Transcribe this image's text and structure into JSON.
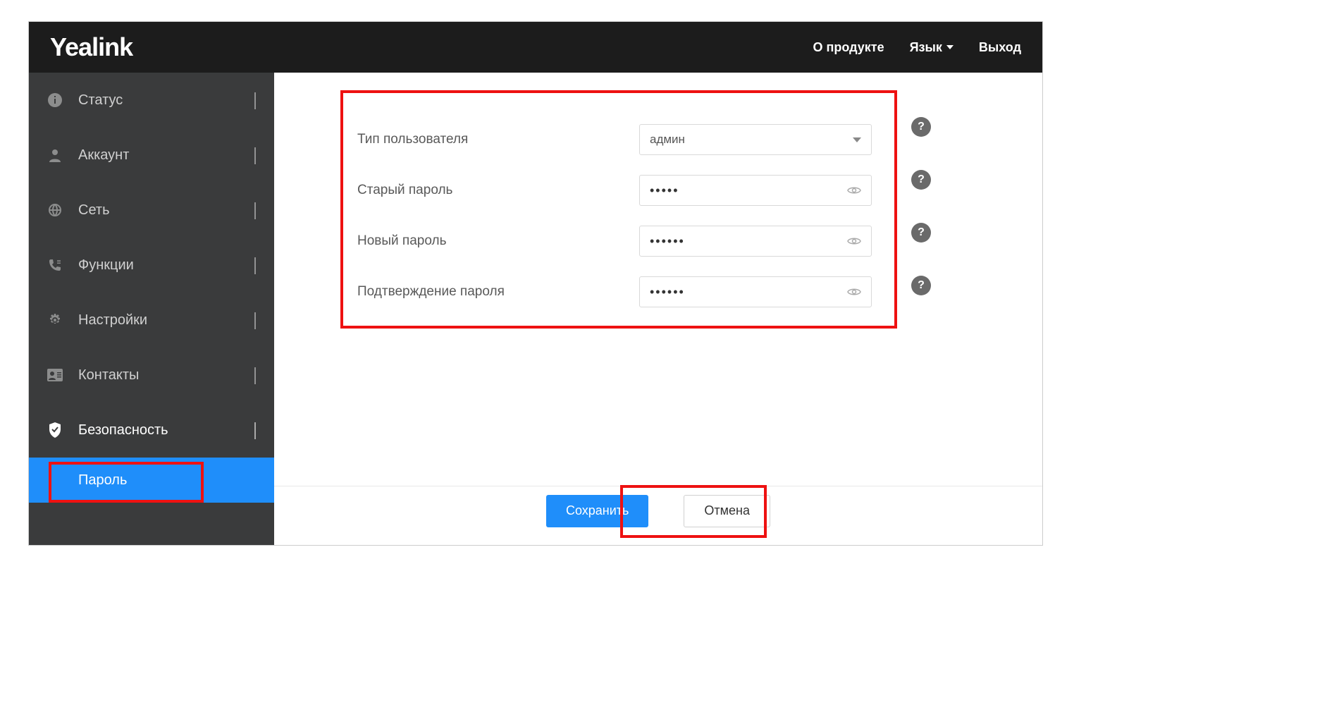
{
  "brand": "Yealink",
  "header": {
    "about": "О продукте",
    "language": "Язык",
    "logout": "Выход"
  },
  "sidebar": {
    "status": "Статус",
    "account": "Аккаунт",
    "network": "Сеть",
    "features": "Функции",
    "settings": "Настройки",
    "contacts": "Контакты",
    "security": "Безопасность",
    "password": "Пароль"
  },
  "form": {
    "user_type_label": "Тип пользователя",
    "user_type_value": "админ",
    "old_password_label": "Старый пароль",
    "old_password_value": "•••••",
    "new_password_label": "Новый пароль",
    "new_password_value": "••••••",
    "confirm_password_label": "Подтверждение пароля",
    "confirm_password_value": "••••••"
  },
  "buttons": {
    "save": "Сохранить",
    "cancel": "Отмена"
  }
}
